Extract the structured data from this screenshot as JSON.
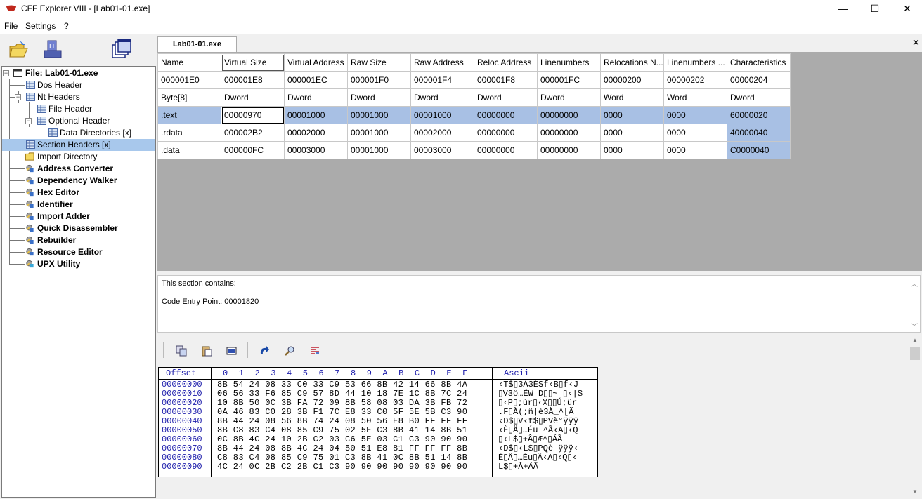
{
  "window": {
    "title": "CFF Explorer VIII - [Lab01-01.exe]",
    "min_glyph": "—",
    "max_glyph": "☐",
    "close_glyph": "✕"
  },
  "menu": [
    "File",
    "Settings",
    "?"
  ],
  "toolbar_icons": [
    "open-folder-icon",
    "save-disk-icon",
    "windows-icon"
  ],
  "tab": {
    "label": "Lab01-01.exe",
    "close_glyph": "✕"
  },
  "tree": [
    {
      "label": "File: Lab01-01.exe",
      "bold": true,
      "icon": "window-icon"
    },
    {
      "label": "Dos Header",
      "icon": "grid-icon"
    },
    {
      "label": "Nt Headers",
      "icon": "grid-icon"
    },
    {
      "label": "File Header",
      "icon": "grid-icon"
    },
    {
      "label": "Optional Header",
      "icon": "grid-icon"
    },
    {
      "label": "Data Directories [x]",
      "icon": "grid-icon"
    },
    {
      "label": "Section Headers [x]",
      "icon": "grid-icon",
      "selected": true
    },
    {
      "label": "Import Directory",
      "icon": "folder-icon"
    },
    {
      "label": "Address Converter",
      "bold": true,
      "icon": "tool-icon"
    },
    {
      "label": "Dependency Walker",
      "bold": true,
      "icon": "tool-icon"
    },
    {
      "label": "Hex Editor",
      "bold": true,
      "icon": "tool-icon"
    },
    {
      "label": "Identifier",
      "bold": true,
      "icon": "tool-icon"
    },
    {
      "label": "Import Adder",
      "bold": true,
      "icon": "tool-icon"
    },
    {
      "label": "Quick Disassembler",
      "bold": true,
      "icon": "tool-icon"
    },
    {
      "label": "Rebuilder",
      "bold": true,
      "icon": "tool-icon"
    },
    {
      "label": "Resource Editor",
      "bold": true,
      "icon": "tool-icon"
    },
    {
      "label": "UPX Utility",
      "bold": true,
      "icon": "upx-icon"
    }
  ],
  "grid": {
    "columns": [
      "Name",
      "Virtual Size",
      "Virtual Address",
      "Raw Size",
      "Raw Address",
      "Reloc Address",
      "Linenumbers",
      "Relocations N...",
      "Linenumbers ...",
      "Characteristics"
    ],
    "offsets": [
      "000001E0",
      "000001E8",
      "000001EC",
      "000001F0",
      "000001F4",
      "000001F8",
      "000001FC",
      "00000200",
      "00000202",
      "00000204"
    ],
    "types": [
      "Byte[8]",
      "Dword",
      "Dword",
      "Dword",
      "Dword",
      "Dword",
      "Dword",
      "Word",
      "Word",
      "Dword"
    ],
    "rows": [
      [
        ".text",
        "00000970",
        "00001000",
        "00001000",
        "00001000",
        "00000000",
        "00000000",
        "0000",
        "0000",
        "60000020"
      ],
      [
        ".rdata",
        "000002B2",
        "00002000",
        "00001000",
        "00002000",
        "00000000",
        "00000000",
        "0000",
        "0000",
        "40000040"
      ],
      [
        ".data",
        "000000FC",
        "00003000",
        "00001000",
        "00003000",
        "00000000",
        "00000000",
        "0000",
        "0000",
        "C0000040"
      ]
    ]
  },
  "info": {
    "line1": "This section contains:",
    "line2": "Code Entry Point: 00001820",
    "up_glyph": "︿",
    "down_glyph": "﹀"
  },
  "hex": {
    "header_offset": "Offset",
    "header_cols": "0  1  2  3  4  5  6  7  8  9  A  B  C  D  E  F",
    "header_ascii": "Ascii",
    "offsets": [
      "00000000",
      "00000010",
      "00000020",
      "00000030",
      "00000040",
      "00000050",
      "00000060",
      "00000070",
      "00000080",
      "00000090"
    ],
    "bytes": [
      "8B 54 24 08 33 C0 33 C9 53 66 8B 42 14 66 8B 4A",
      "06 56 33 F6 85 C9 57 8D 44 10 18 7E 1C 8B 7C 24",
      "10 8B 50 0C 3B FA 72 09 8B 58 08 03 DA 3B FB 72",
      "0A 46 83 C0 28 3B F1 7C E8 33 C0 5F 5E 5B C3 90",
      "8B 44 24 08 56 8B 74 24 08 50 56 E8 B0 FF FF FF",
      "8B C8 83 C4 08 85 C9 75 02 5E C3 8B 41 14 8B 51",
      "0C 8B 4C 24 10 2B C2 03 C6 5E 03 C1 C3 90 90 90",
      "8B 44 24 08 8B 4C 24 04 50 51 E8 81 FF FF FF 8B",
      "C8 83 C4 08 85 C9 75 01 C3 8B 41 0C 8B 51 14 8B",
      "4C 24 0C 2B C2 2B C1 C3 90 90 90 90 90 90 90 90"
    ],
    "ascii": [
      "‹T$▯3À3ÉSf‹B▯f‹J",
      "▯V3ö…ÉW D▯▯~ ▯‹|$",
      "▯‹P▯;úr▯‹X▯▯Ú;ûr",
      ".F▯À(;ñ|è3À_^[Ã",
      "‹D$▯V‹t$▯PVè°ÿÿÿ",
      "‹È▯Ä▯…Éu ^Ã‹A▯‹Q",
      "▯‹L$▯+Â▯Æ^▯ÁÃ",
      "‹D$▯‹L$▯PQè ÿÿÿ‹",
      "È▯Ä▯…Éu▯Ã‹A▯‹Q▯‹",
      "L$▯+Â+ÁÃ"
    ]
  }
}
